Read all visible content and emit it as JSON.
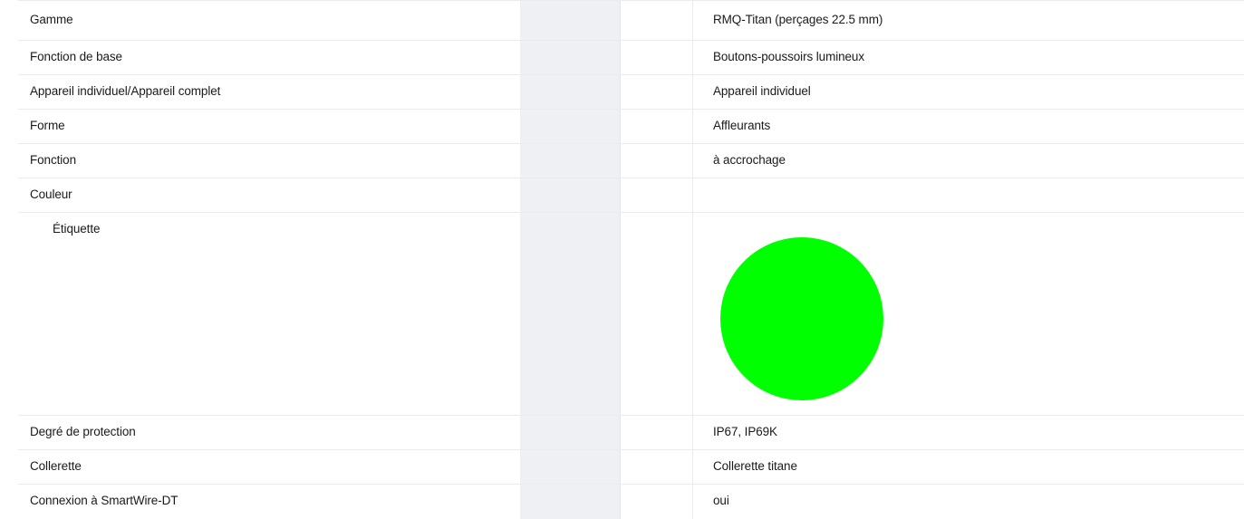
{
  "rows": [
    {
      "label": "Gamme",
      "value": "RMQ-Titan (perçages 22.5 mm)"
    },
    {
      "label": "Fonction de base",
      "value": "Boutons-poussoirs lumineux"
    },
    {
      "label": "Appareil individuel/Appareil complet",
      "value": "Appareil individuel"
    },
    {
      "label": "Forme",
      "value": "Affleurants"
    },
    {
      "label": "Fonction",
      "value": "à accrochage"
    },
    {
      "label": "Couleur",
      "value": ""
    },
    {
      "label": "Étiquette",
      "swatch_color": "#00ff00",
      "swatch_icon": "green-circle-icon"
    },
    {
      "label": "Degré de protection",
      "value": "IP67, IP69K"
    },
    {
      "label": "Collerette",
      "value": "Collerette titane"
    },
    {
      "label": "Connexion à SmartWire-DT",
      "value": "oui"
    }
  ]
}
